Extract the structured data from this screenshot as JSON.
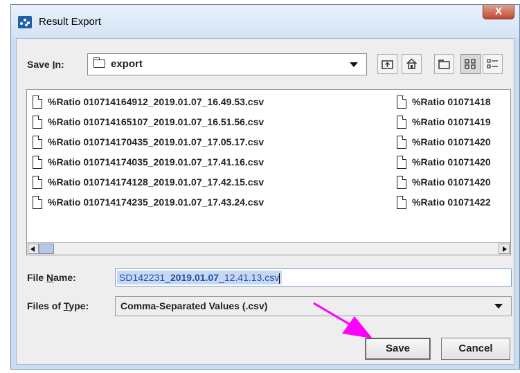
{
  "window": {
    "title": "Result Export",
    "close_glyph": "X"
  },
  "save_in": {
    "label_prefix": "Save ",
    "label_key": "I",
    "label_suffix": "n:",
    "value": "export"
  },
  "toolbar": {
    "icons": [
      "up-folder-icon",
      "home-icon",
      "new-folder-icon",
      "list-view-icon",
      "details-view-icon"
    ]
  },
  "files": {
    "column1": [
      "%Ratio 010714164912_2019.01.07_16.49.53.csv",
      "%Ratio 010714165107_2019.01.07_16.51.56.csv",
      "%Ratio 010714170435_2019.01.07_17.05.17.csv",
      "%Ratio 010714174035_2019.01.07_17.41.16.csv",
      "%Ratio 010714174128_2019.01.07_17.42.15.csv",
      "%Ratio 010714174235_2019.01.07_17.43.24.csv"
    ],
    "column2": [
      "%Ratio 01071418",
      "%Ratio 01071419",
      "%Ratio 01071420",
      "%Ratio 01071420",
      "%Ratio 01071420",
      "%Ratio 01071422"
    ]
  },
  "file_name": {
    "label_prefix": "File ",
    "label_key": "N",
    "label_suffix": "ame:",
    "value_part1": "SD142231_",
    "value_bold": "2019.01.07",
    "value_part3": "_12.41.13.csv"
  },
  "file_type": {
    "label_prefix": "Files of ",
    "label_key": "T",
    "label_suffix": "ype:",
    "value": "Comma-Separated Values (.csv)"
  },
  "buttons": {
    "save": "Save",
    "cancel": "Cancel"
  },
  "annotation": {
    "arrow_color": "#ff00ff"
  }
}
